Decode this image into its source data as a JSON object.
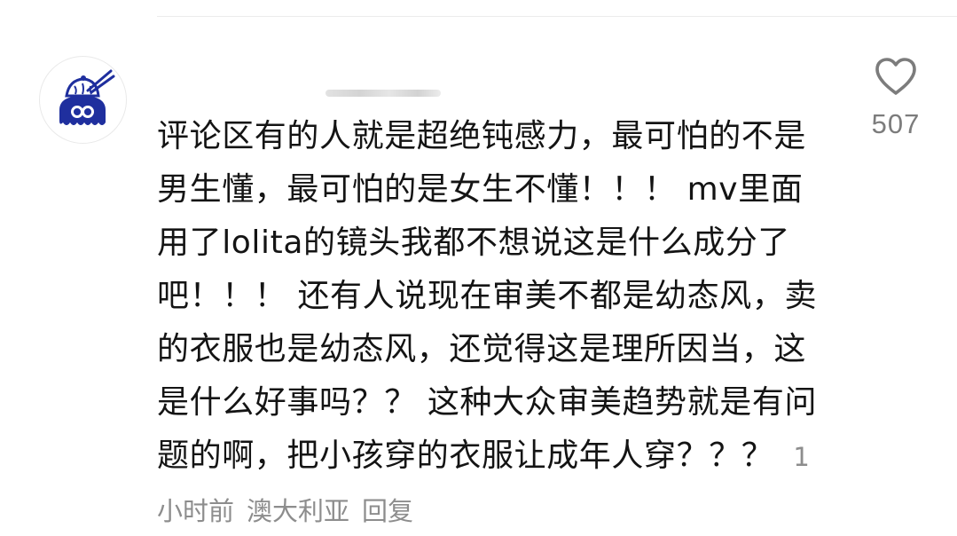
{
  "comment": {
    "text": "评论区有的人就是超绝钝感力，最可怕的不是男生懂，最可怕的是女生不懂！！！ mv里面用了lolita的镜头我都不想说这是什么成分了吧！！！ 还有人说现在审美不都是幼态风，卖的衣服也是幼态风，还觉得这是理所因当，这是什么好事吗？？ 这种大众审美趋势就是有问题的啊，把小孩穿的衣服让成年人穿？？？",
    "time": "1小时前",
    "location": "澳大利亚",
    "reply_label": "回复"
  },
  "like": {
    "icon": "heart-outline-icon",
    "count": "507"
  },
  "avatar": {
    "icon": "squid-with-bun-avatar",
    "color": "#1f2f9e"
  },
  "colors": {
    "text": "#141414",
    "meta": "#8d8d8d",
    "like": "#7c7c7c"
  }
}
